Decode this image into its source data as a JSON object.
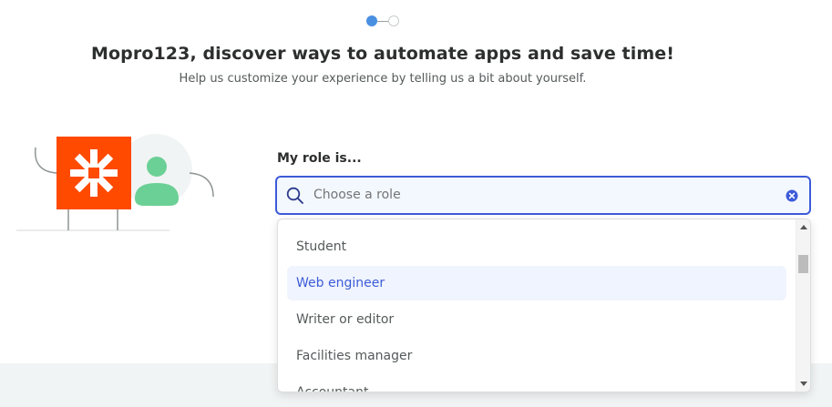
{
  "onboarding": {
    "title": "Mopro123, discover ways to automate apps and save time!",
    "subtitle": "Help us customize your experience by telling us a bit about yourself.",
    "steps": {
      "current": 1,
      "total": 2
    }
  },
  "role_picker": {
    "label": "My role is...",
    "placeholder": "Choose a role",
    "value": "",
    "options": [
      {
        "label": "Student"
      },
      {
        "label": "Web engineer"
      },
      {
        "label": "Writer or editor"
      },
      {
        "label": "Facilities manager"
      },
      {
        "label": "Accountant"
      }
    ],
    "highlighted_option": "Web engineer"
  },
  "colors": {
    "accent": "#3d5bd9",
    "brand_orange": "#ff4a00",
    "avatar_green": "#6bd096",
    "step_active": "#4a90e2"
  },
  "icons": {
    "search": "search-icon",
    "clear": "clear-icon",
    "logo": "zapier-asterisk-icon",
    "user": "user-avatar-icon"
  }
}
